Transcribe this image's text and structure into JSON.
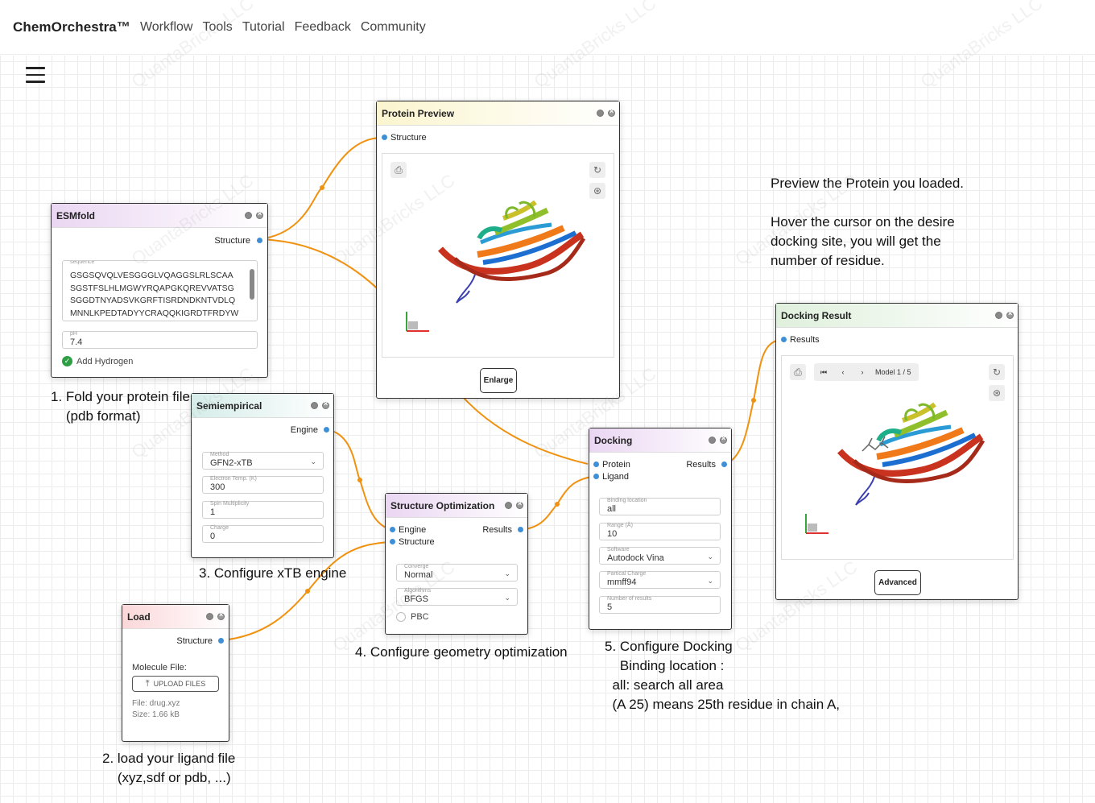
{
  "topbar": {
    "brand": "ChemOrchestra™",
    "nav": [
      "Workflow",
      "Tools",
      "Tutorial",
      "Feedback",
      "Community"
    ]
  },
  "watermark": "QuantaBricks LLC",
  "nodes": {
    "esmfold": {
      "title": "ESMfold",
      "output": "Structure",
      "sequence_label": "sequence",
      "sequence": "GSGSQVQLVESGGGLVQAGGSLRLSCAA\nSGSTFSLHLMGWYRQAPGKQREVVATSG\nSGGDTNYADSVKGRFTISRDNDKNTVDLQ\nMNNLKPEDTADYYCRAQQKIGRDTFRDYW\nGQGTQVTVSS",
      "ph_label": "pH",
      "ph": "7.4",
      "hydrogen_label": "Add Hydrogen",
      "header_color": "#ead6f2"
    },
    "protein_preview": {
      "title": "Protein Preview",
      "input": "Structure",
      "button": "Enlarge",
      "header_color": "#fbf5cf"
    },
    "semiempirical": {
      "title": "Semiempirical",
      "output": "Engine",
      "method_label": "Method",
      "method": "GFN2-xTB",
      "etemp_label": "Electron Temp. (K)",
      "etemp": "300",
      "spin_label": "Spin Multiplicity",
      "spin": "1",
      "charge_label": "Charge",
      "charge": "0",
      "header_color": "#d5ede9"
    },
    "structure_optimization": {
      "title": "Structure Optimization",
      "input_engine": "Engine",
      "input_structure": "Structure",
      "output": "Results",
      "converge_label": "Converge",
      "converge": "Normal",
      "algorithm_label": "Algorithms",
      "algorithm": "BFGS",
      "pbc_label": "PBC",
      "header_color": "#ead6f2"
    },
    "load": {
      "title": "Load",
      "output": "Structure",
      "file_label": "Molecule File:",
      "upload_button": "UPLOAD FILES",
      "file_name": "File: drug.xyz",
      "file_size": "Size: 1.66 kB",
      "header_color": "#fbd7d9"
    },
    "docking": {
      "title": "Docking",
      "input_protein": "Protein",
      "input_ligand": "Ligand",
      "output": "Results",
      "binding_label": "Binding location",
      "binding": "all",
      "range_label": "Range (Å)",
      "range": "10",
      "software_label": "Software",
      "software": "Autodock Vina",
      "charge_label": "Partical Charge",
      "charge": "mmff94",
      "results_label": "Number of results",
      "results": "5",
      "header_color": "#ead6f2"
    },
    "docking_result": {
      "title": "Docking Result",
      "input": "Results",
      "model_label": "Model 1 / 5",
      "button": "Advanced",
      "header_color": "#dff0dc"
    }
  },
  "annotations": {
    "step1": [
      "1. Fold your protein file",
      "    (pdb format)"
    ],
    "step2": [
      "2. load your ligand file",
      "    (xyz,sdf or pdb, ...)"
    ],
    "step3": [
      "3. Configure xTB engine"
    ],
    "step4": [
      "4. Configure geometry optimization"
    ],
    "step5": [
      "5. Configure Docking",
      "    Binding location :",
      "  all: search all area",
      "  (A 25) means 25th residue in chain A,"
    ],
    "preview": [
      "Preview the Protein you loaded.",
      "",
      "Hover the cursor on the desire",
      "docking site, you will get the",
      "number of residue."
    ]
  },
  "colors": {
    "edge": "#f0920f",
    "port": "#3f8fd6",
    "checkbox": "#2e9e44"
  }
}
